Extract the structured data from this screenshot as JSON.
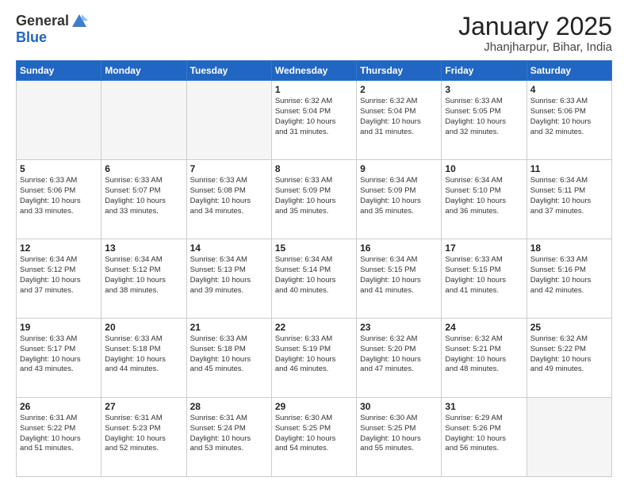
{
  "header": {
    "logo_general": "General",
    "logo_blue": "Blue",
    "month_title": "January 2025",
    "location": "Jhanjharpur, Bihar, India"
  },
  "weekdays": [
    "Sunday",
    "Monday",
    "Tuesday",
    "Wednesday",
    "Thursday",
    "Friday",
    "Saturday"
  ],
  "weeks": [
    [
      {
        "day": "",
        "info": ""
      },
      {
        "day": "",
        "info": ""
      },
      {
        "day": "",
        "info": ""
      },
      {
        "day": "1",
        "info": "Sunrise: 6:32 AM\nSunset: 5:04 PM\nDaylight: 10 hours\nand 31 minutes."
      },
      {
        "day": "2",
        "info": "Sunrise: 6:32 AM\nSunset: 5:04 PM\nDaylight: 10 hours\nand 31 minutes."
      },
      {
        "day": "3",
        "info": "Sunrise: 6:33 AM\nSunset: 5:05 PM\nDaylight: 10 hours\nand 32 minutes."
      },
      {
        "day": "4",
        "info": "Sunrise: 6:33 AM\nSunset: 5:06 PM\nDaylight: 10 hours\nand 32 minutes."
      }
    ],
    [
      {
        "day": "5",
        "info": "Sunrise: 6:33 AM\nSunset: 5:06 PM\nDaylight: 10 hours\nand 33 minutes."
      },
      {
        "day": "6",
        "info": "Sunrise: 6:33 AM\nSunset: 5:07 PM\nDaylight: 10 hours\nand 33 minutes."
      },
      {
        "day": "7",
        "info": "Sunrise: 6:33 AM\nSunset: 5:08 PM\nDaylight: 10 hours\nand 34 minutes."
      },
      {
        "day": "8",
        "info": "Sunrise: 6:33 AM\nSunset: 5:09 PM\nDaylight: 10 hours\nand 35 minutes."
      },
      {
        "day": "9",
        "info": "Sunrise: 6:34 AM\nSunset: 5:09 PM\nDaylight: 10 hours\nand 35 minutes."
      },
      {
        "day": "10",
        "info": "Sunrise: 6:34 AM\nSunset: 5:10 PM\nDaylight: 10 hours\nand 36 minutes."
      },
      {
        "day": "11",
        "info": "Sunrise: 6:34 AM\nSunset: 5:11 PM\nDaylight: 10 hours\nand 37 minutes."
      }
    ],
    [
      {
        "day": "12",
        "info": "Sunrise: 6:34 AM\nSunset: 5:12 PM\nDaylight: 10 hours\nand 37 minutes."
      },
      {
        "day": "13",
        "info": "Sunrise: 6:34 AM\nSunset: 5:12 PM\nDaylight: 10 hours\nand 38 minutes."
      },
      {
        "day": "14",
        "info": "Sunrise: 6:34 AM\nSunset: 5:13 PM\nDaylight: 10 hours\nand 39 minutes."
      },
      {
        "day": "15",
        "info": "Sunrise: 6:34 AM\nSunset: 5:14 PM\nDaylight: 10 hours\nand 40 minutes."
      },
      {
        "day": "16",
        "info": "Sunrise: 6:34 AM\nSunset: 5:15 PM\nDaylight: 10 hours\nand 41 minutes."
      },
      {
        "day": "17",
        "info": "Sunrise: 6:33 AM\nSunset: 5:15 PM\nDaylight: 10 hours\nand 41 minutes."
      },
      {
        "day": "18",
        "info": "Sunrise: 6:33 AM\nSunset: 5:16 PM\nDaylight: 10 hours\nand 42 minutes."
      }
    ],
    [
      {
        "day": "19",
        "info": "Sunrise: 6:33 AM\nSunset: 5:17 PM\nDaylight: 10 hours\nand 43 minutes."
      },
      {
        "day": "20",
        "info": "Sunrise: 6:33 AM\nSunset: 5:18 PM\nDaylight: 10 hours\nand 44 minutes."
      },
      {
        "day": "21",
        "info": "Sunrise: 6:33 AM\nSunset: 5:18 PM\nDaylight: 10 hours\nand 45 minutes."
      },
      {
        "day": "22",
        "info": "Sunrise: 6:33 AM\nSunset: 5:19 PM\nDaylight: 10 hours\nand 46 minutes."
      },
      {
        "day": "23",
        "info": "Sunrise: 6:32 AM\nSunset: 5:20 PM\nDaylight: 10 hours\nand 47 minutes."
      },
      {
        "day": "24",
        "info": "Sunrise: 6:32 AM\nSunset: 5:21 PM\nDaylight: 10 hours\nand 48 minutes."
      },
      {
        "day": "25",
        "info": "Sunrise: 6:32 AM\nSunset: 5:22 PM\nDaylight: 10 hours\nand 49 minutes."
      }
    ],
    [
      {
        "day": "26",
        "info": "Sunrise: 6:31 AM\nSunset: 5:22 PM\nDaylight: 10 hours\nand 51 minutes."
      },
      {
        "day": "27",
        "info": "Sunrise: 6:31 AM\nSunset: 5:23 PM\nDaylight: 10 hours\nand 52 minutes."
      },
      {
        "day": "28",
        "info": "Sunrise: 6:31 AM\nSunset: 5:24 PM\nDaylight: 10 hours\nand 53 minutes."
      },
      {
        "day": "29",
        "info": "Sunrise: 6:30 AM\nSunset: 5:25 PM\nDaylight: 10 hours\nand 54 minutes."
      },
      {
        "day": "30",
        "info": "Sunrise: 6:30 AM\nSunset: 5:25 PM\nDaylight: 10 hours\nand 55 minutes."
      },
      {
        "day": "31",
        "info": "Sunrise: 6:29 AM\nSunset: 5:26 PM\nDaylight: 10 hours\nand 56 minutes."
      },
      {
        "day": "",
        "info": ""
      }
    ]
  ]
}
